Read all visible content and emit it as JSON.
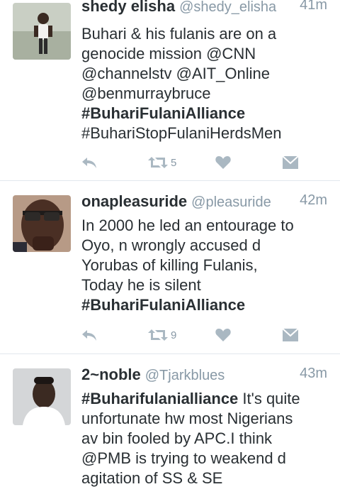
{
  "feed": {
    "tweets": [
      {
        "name": "shedy elisha",
        "handle": "@shedy_elisha",
        "time": "41m",
        "lines": [
          "Buhari & his fulanis are on a",
          "genocide mission @CNN",
          "@channelstv @AIT_Online",
          "@benmurraybruce"
        ],
        "tags": [
          "#BuhariFulaniAlliance"
        ],
        "extra_line": "#BuhariStopFulaniHerdsMen",
        "retweet_count": "5"
      },
      {
        "name": "onapleasuride",
        "handle": "@pleasuride",
        "time": "42m",
        "lines": [
          "In 2000 he led an entourage to",
          "Oyo, n wrongly accused d",
          "Yorubas of killing Fulanis,",
          "Today he is silent"
        ],
        "tags": [
          "#BuhariFulaniAlliance"
        ],
        "retweet_count": "9"
      },
      {
        "name": "2~noble",
        "handle": "@Tjarkblues",
        "time": "43m",
        "tag_lead": "#Buharifulanialliance",
        "lead_rest": " It's quite",
        "lines": [
          "unfortunate hw most Nigerians",
          "av bin fooled by APC.I think",
          "@PMB is trying to weakend d",
          "agitation of SS & SE"
        ]
      }
    ]
  },
  "icons": {
    "reply": "reply-icon",
    "retweet": "retweet-icon",
    "like": "heart-icon",
    "dm": "envelope-icon"
  },
  "colors": {
    "text": "#292f33",
    "secondary": "#8899a6",
    "action": "#aab8c2",
    "accent": "#1da1f2"
  }
}
